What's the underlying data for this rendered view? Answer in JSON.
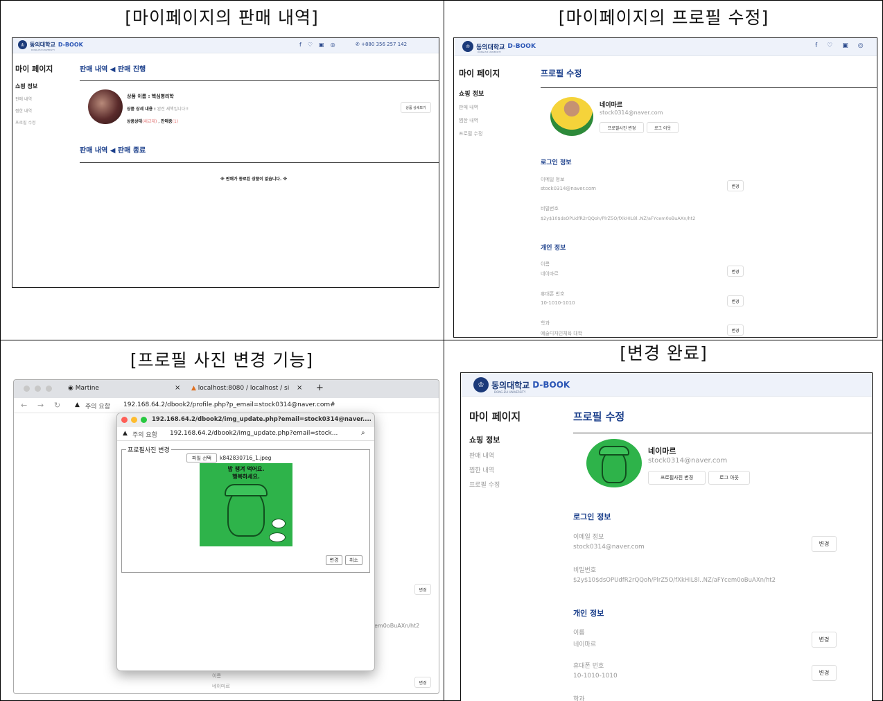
{
  "captions": {
    "top_left": "[마이페이지의 판매 내역]",
    "top_right": "[마이페이지의 프로필 수정]",
    "bottom_left": "[프로필 사진 변경 기능]",
    "bottom_right": "[변경 완료]"
  },
  "site": {
    "logo_text": "동의대학교",
    "logo_brand": "D-BOOK",
    "logo_sub": "DONG-EUI UNIVERSITY",
    "phone": "+880 356 257 142",
    "social_icons": [
      "facebook-icon",
      "twitter-icon",
      "copy-icon",
      "instagram-icon"
    ]
  },
  "sidebar": {
    "title": "마이 페이지",
    "section": "쇼핑 정보",
    "items": [
      "판매 내역",
      "찜한 내역",
      "프로필 수정"
    ]
  },
  "sales": {
    "heading_progress": "판매 내역 ◀ 판매 진행",
    "heading_done": "판매 내역 ◀ 판매 종료",
    "product_name_label": "상품 이름 :",
    "product_name": "핵심병리학",
    "product_detail_label": "상품 상세 내용 :",
    "product_detail": "완전 새책입니다!!",
    "product_status_label": "상품상태",
    "product_status_value": "(새교재)",
    "product_sale_label": "판매중",
    "product_sale_count": "(1)",
    "detail_button": "상품 상세보기",
    "empty_message": "※ 판매가 종료된 상품이 없습니다. ※"
  },
  "profile": {
    "heading": "프로필 수정",
    "name": "네이마르",
    "email": "stock0314@naver.com",
    "change_photo_button": "프로필사진 변경",
    "logout_button": "로그 아웃",
    "login_section": "로그인 정보",
    "email_label": "이메일 정보",
    "password_label": "비밀번호",
    "password_hash": "$2y$10$dsOPUdfR2rQQoh/PlrZ5O/fXkHIL8l..NZ/aFYcem0oBuAXn/ht2",
    "personal_section": "개인 정보",
    "name_label": "이름",
    "phone_label": "휴대폰 번호",
    "phone_value": "10-1010-1010",
    "dept_label": "학과",
    "dept_value": "예술디자인체육 대학",
    "change_button": "변경"
  },
  "browser": {
    "tab1": "Martine",
    "tab2": "localhost:8080 / localhost / si",
    "warning": "주의 요함",
    "url": "192.168.64.2/dbook2/profile.php?p_email=stock0314@naver.com#",
    "popup_title_url": "192.168.64.2/dbook2/img_update.php?email=stock0314@naver....",
    "popup_addr_url": "192.168.64.2/dbook2/img_update.php?email=stock...",
    "fieldset_legend": "프로필사진 변경",
    "file_button": "파일 선택",
    "file_name": "k842830716_1.jpeg",
    "confirm_button": "변경",
    "cancel_button": "취소",
    "comic_text": "밥 챙겨 먹어요.\n행복하세요.",
    "bg_hash_fragment": "em0oBuAXn/ht2",
    "bg_name_label": "이름",
    "bg_name_value": "네이마르",
    "bg_change": "변경"
  }
}
